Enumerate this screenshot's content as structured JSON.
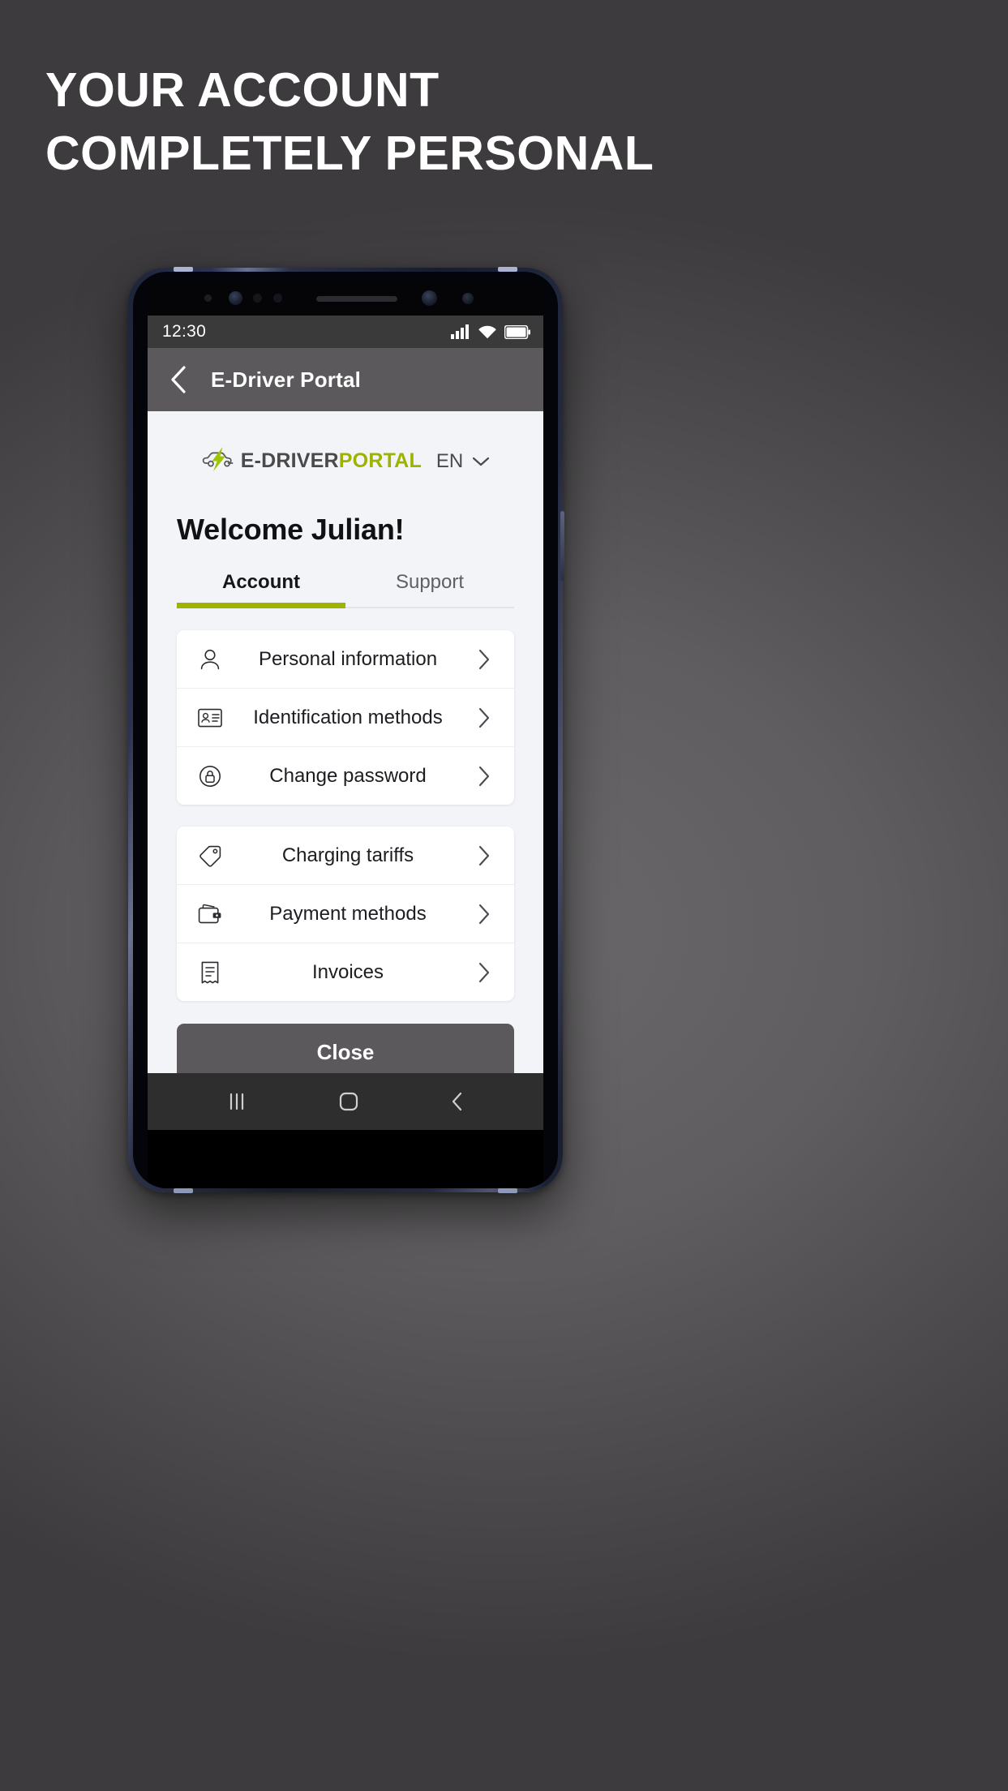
{
  "promo": {
    "headline": "YOUR ACCOUNT\nCOMPLETELY PERSONAL",
    "background_color": "#5c5a5c"
  },
  "device": {
    "statusbar": {
      "clock": "12:30",
      "icons": [
        "signal-icon",
        "wifi-icon",
        "battery-icon"
      ],
      "background_color": "#3a3a3a"
    },
    "navbar": {
      "items": [
        "recents-button",
        "home-button",
        "back-button"
      ],
      "background_color": "#2e2e2e"
    }
  },
  "appbar": {
    "back_icon": "chevron-left-icon",
    "title": "E-Driver Portal",
    "background_color": "#5b595b"
  },
  "webview": {
    "brand": {
      "icon": "car-bolt-icon",
      "name_dark": "E-DRIVER",
      "name_green": "PORTAL",
      "dark_color": "#4a4a4d",
      "green_color": "#9db300"
    },
    "language": {
      "value": "EN",
      "chevron_icon": "chevron-down-icon"
    },
    "welcome": "Welcome Julian!",
    "tabs": [
      {
        "label": "Account",
        "active": true
      },
      {
        "label": "Support",
        "active": false
      }
    ],
    "accent_color": "#9db300",
    "groups": [
      {
        "rows": [
          {
            "icon": "person-icon",
            "label": "Personal information",
            "arrow": "chevron-right-icon"
          },
          {
            "icon": "id-card-icon",
            "label": "Identification methods",
            "arrow": "chevron-right-icon"
          },
          {
            "icon": "lock-shield-icon",
            "label": "Change password",
            "arrow": "chevron-right-icon"
          }
        ]
      },
      {
        "rows": [
          {
            "icon": "tag-icon",
            "label": "Charging tariffs",
            "arrow": "chevron-right-icon"
          },
          {
            "icon": "wallet-icon",
            "label": "Payment methods",
            "arrow": "chevron-right-icon"
          },
          {
            "icon": "invoice-icon",
            "label": "Invoices",
            "arrow": "chevron-right-icon"
          }
        ]
      }
    ],
    "close_button": "Close",
    "background_color": "#f3f4f7"
  }
}
